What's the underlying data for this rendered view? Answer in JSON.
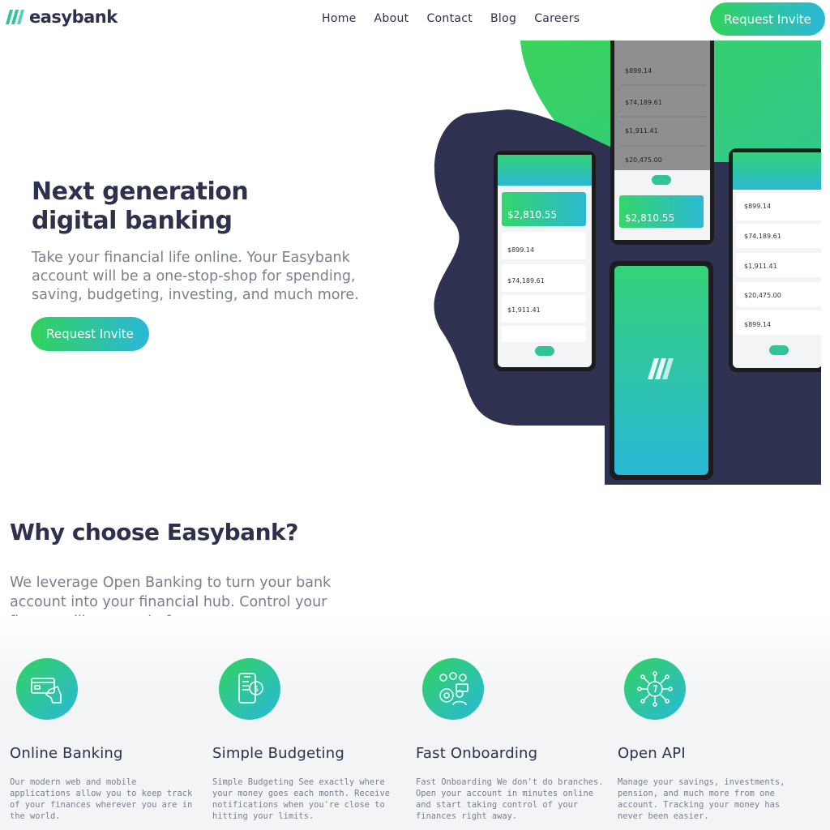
{
  "brand": {
    "name": "easybank"
  },
  "nav": {
    "items": [
      "Home",
      "About",
      "Contact",
      "Blog",
      "Careers"
    ]
  },
  "header": {
    "cta_label": "Request Invite"
  },
  "hero": {
    "title": "Next generation digital banking",
    "description": "Take your financial life online. Your Easybank account will be a one-stop-shop for spending, saving, budgeting, investing, and much more.",
    "cta_label": "Request Invite",
    "phone_screens": {
      "balance": "$2,810.55",
      "amounts": [
        "$899.14",
        "$74,189.61",
        "$1,911.41",
        "$20,475.00"
      ]
    }
  },
  "why": {
    "title": "Why choose Easybank?",
    "description": "We leverage Open Banking to turn your bank account into your financial hub. Control your finances like never before."
  },
  "features": [
    {
      "icon": "credit-card-hand-icon",
      "title": "Online Banking",
      "text": "Our modern web and mobile applications allow you to keep track of your finances wherever you are in the world."
    },
    {
      "icon": "mobile-budget-icon",
      "title": "Simple Budgeting",
      "text": "Simple Budgeting See exactly where your money goes each month. Receive notifications when you're close to hitting your limits."
    },
    {
      "icon": "onboarding-people-icon",
      "title": "Fast Onboarding",
      "text": "Fast Onboarding We don't do branches. Open your account in minutes online and start taking control of your finances right away."
    },
    {
      "icon": "api-circuit-icon",
      "title": "Open API",
      "text": "Manage your savings, investments, pension, and much more from one account. Tracking your money has never been easier."
    }
  ],
  "colors": {
    "dark_blue": "#2d314d",
    "lime_green": "#31d35c",
    "bright_cyan": "#2bb7da",
    "grayish_blue": "#7b7e8f"
  }
}
